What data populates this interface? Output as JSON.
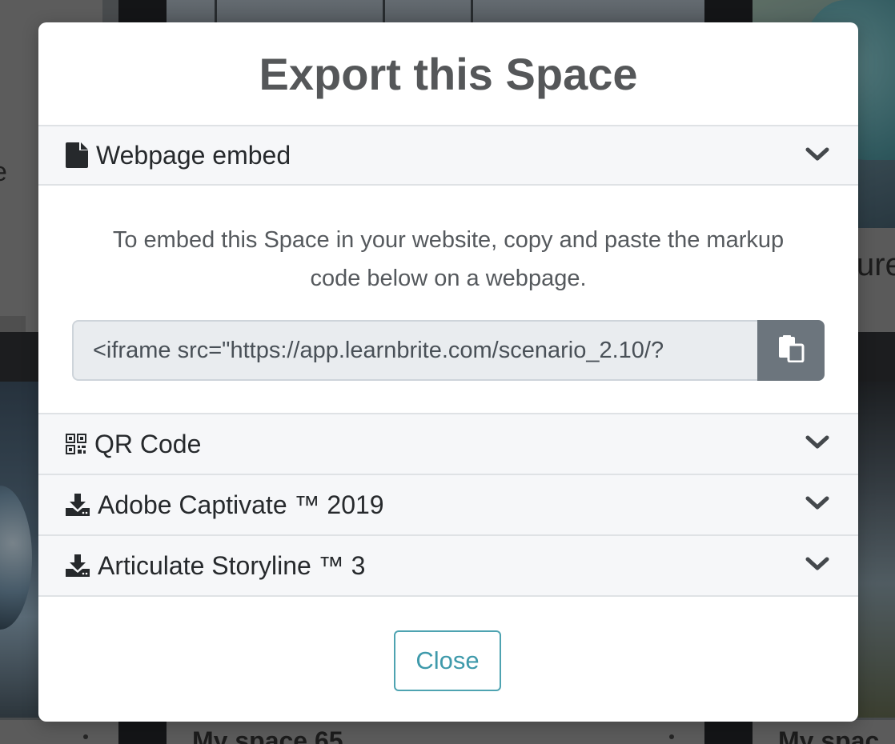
{
  "modal": {
    "title": "Export this Space",
    "sections": [
      {
        "label": "Webpage embed",
        "icon": "file-icon",
        "expanded": true
      },
      {
        "label": "QR Code",
        "icon": "qr-code-icon",
        "expanded": false
      },
      {
        "label": "Adobe Captivate ™ 2019",
        "icon": "download-icon",
        "expanded": false
      },
      {
        "label": "Articulate Storyline ™ 3",
        "icon": "download-icon",
        "expanded": false
      }
    ],
    "embed": {
      "description": "To embed this Space in your website, copy and paste the markup code below on a webpage.",
      "code": "<iframe src=\"https://app.learnbrite.com/scenario_2.10/?",
      "copy_icon": "copy-icon"
    },
    "close_label": "Close"
  },
  "background": {
    "right_caption_fragment": "ure",
    "left_caption_fragment": "e",
    "bottom_card_title_1": "My space 65",
    "bottom_card_title_2": "My spac"
  },
  "colors": {
    "accent": "#3f9aab",
    "copy_button": "#6c757d",
    "header_bg": "#f6f7f9",
    "input_bg": "#e9ecef"
  }
}
